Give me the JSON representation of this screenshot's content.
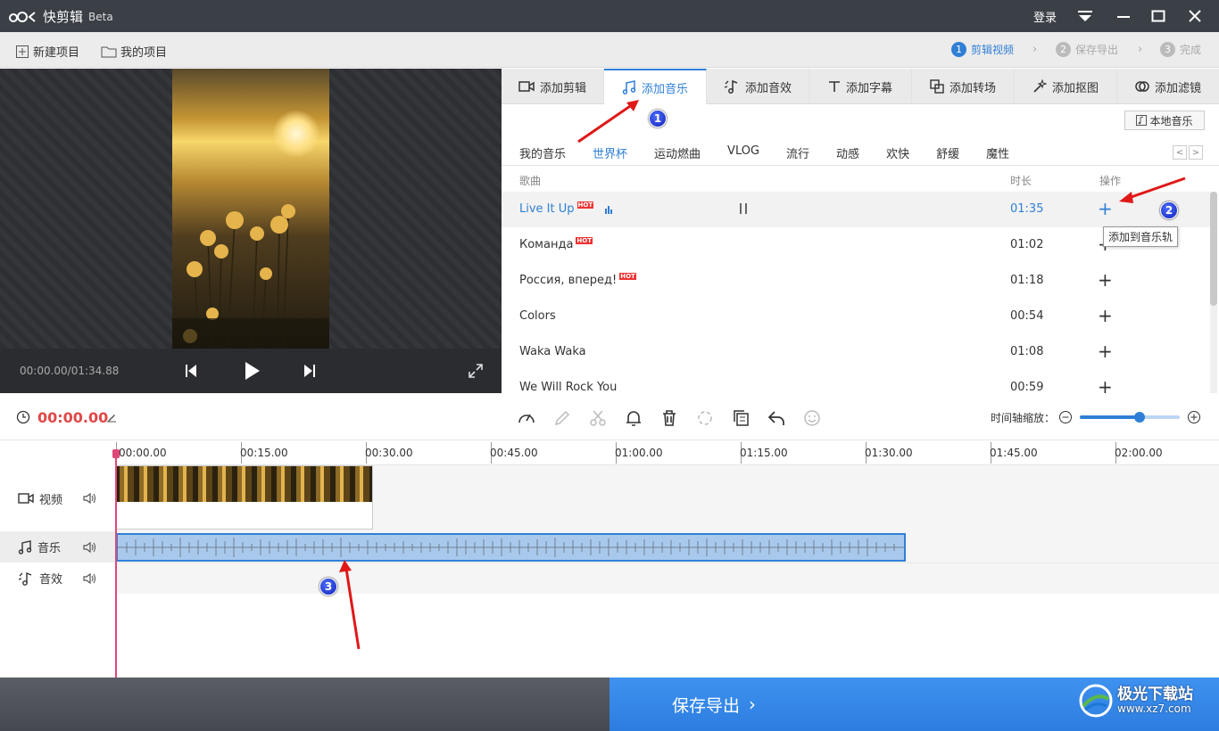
{
  "app": {
    "title": "快剪辑",
    "beta": "Beta",
    "login": "登录"
  },
  "toolbar": {
    "new_project": "新建项目",
    "my_projects": "我的项目"
  },
  "steps": [
    {
      "num": "1",
      "label": "剪辑视频"
    },
    {
      "num": "2",
      "label": "保存导出"
    },
    {
      "num": "3",
      "label": "完成"
    }
  ],
  "preview": {
    "timecode": "00:00.00/01:34.88"
  },
  "tabs": [
    "添加剪辑",
    "添加音乐",
    "添加音效",
    "添加字幕",
    "添加转场",
    "添加抠图",
    "添加滤镜"
  ],
  "local_music": "本地音乐",
  "categories": [
    "我的音乐",
    "世界杯",
    "运动燃曲",
    "VLOG",
    "流行",
    "动感",
    "欢快",
    "舒缓",
    "魔性"
  ],
  "list": {
    "col_song": "歌曲",
    "col_duration": "时长",
    "col_action": "操作",
    "hot": "HOT",
    "rows": [
      {
        "title": "Live It Up",
        "duration": "01:35",
        "hot": true
      },
      {
        "title": "Команда",
        "duration": "01:02",
        "hot": true
      },
      {
        "title": "Россия, вперед!",
        "duration": "01:18",
        "hot": true
      },
      {
        "title": "Colors",
        "duration": "00:54",
        "hot": false
      },
      {
        "title": "Waka Waka",
        "duration": "01:08",
        "hot": false
      },
      {
        "title": "We Will Rock You",
        "duration": "00:59",
        "hot": false
      }
    ],
    "tooltip": "添加到音乐轨"
  },
  "annotations": [
    "1",
    "2",
    "3"
  ],
  "timeline": {
    "current_time": "00:00.00",
    "zoom_label": "时间轴缩放：",
    "zoom_level": 0.6,
    "ticks": [
      "00:00.00",
      "00:15.00",
      "00:30.00",
      "00:45.00",
      "01:00.00",
      "01:15.00",
      "01:30.00",
      "01:45.00",
      "02:00.00"
    ],
    "tracks": {
      "video": "视频",
      "music": "音乐",
      "sfx": "音效"
    }
  },
  "footer": {
    "save_export": "保存导出",
    "watermark_cn": "极光下载站",
    "watermark_url": "www.xz7.com"
  },
  "colors": {
    "accent": "#2f7fd6",
    "timecode": "#e04848",
    "titlebar": "#3b3f46"
  }
}
